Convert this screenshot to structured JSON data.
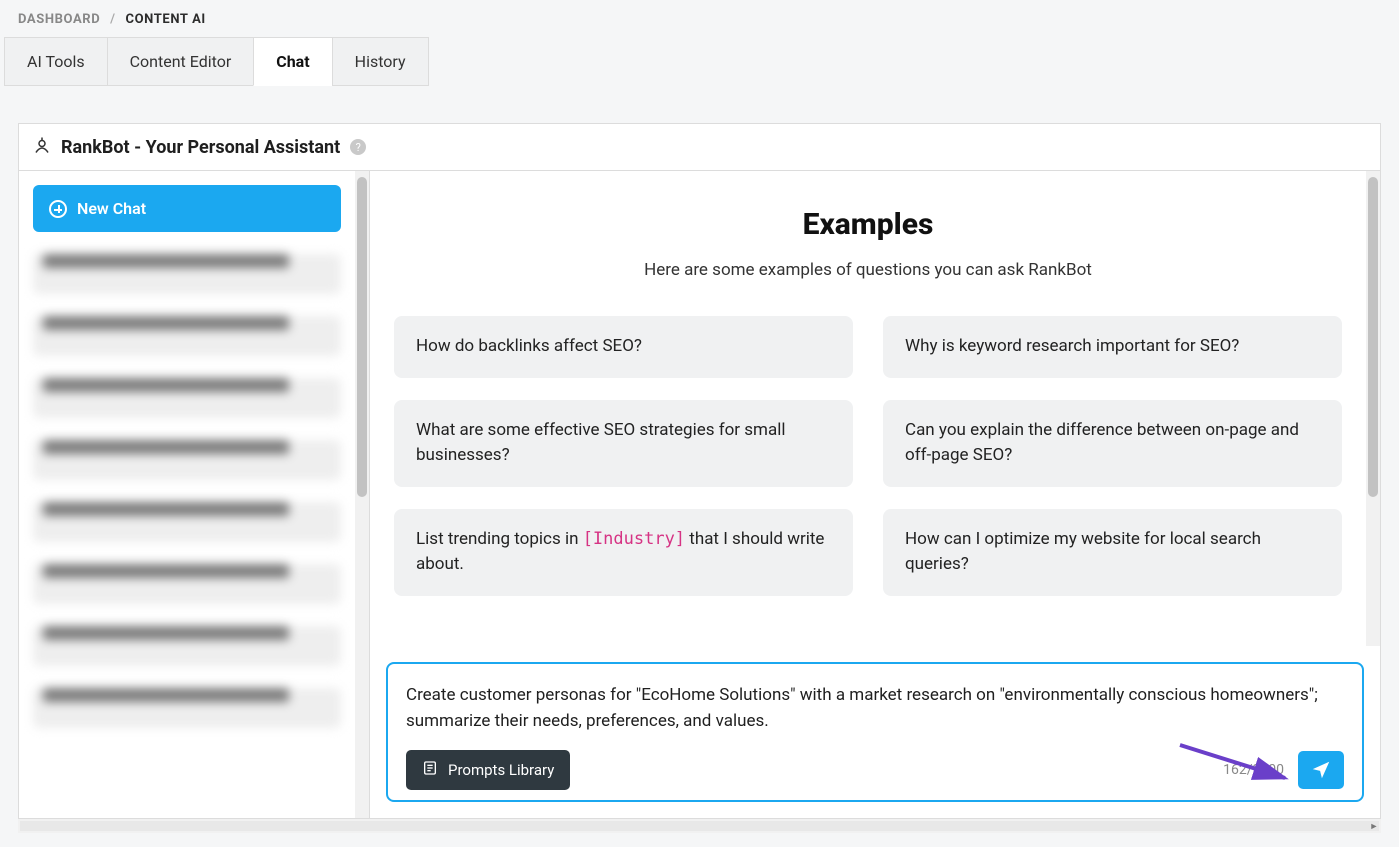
{
  "breadcrumb": {
    "root": "DASHBOARD",
    "current": "CONTENT AI"
  },
  "tabs": {
    "ai_tools": "AI Tools",
    "content_editor": "Content Editor",
    "chat": "Chat",
    "history": "History"
  },
  "panel": {
    "title": "RankBot - Your Personal Assistant",
    "new_chat_label": "New Chat"
  },
  "examples": {
    "heading": "Examples",
    "subheading": "Here are some examples of questions you can ask RankBot",
    "items": [
      "How do backlinks affect SEO?",
      "Why is keyword research important for SEO?",
      "What are some effective SEO strategies for small businesses?",
      "Can you explain the difference between on-page and off-page SEO?",
      {
        "pre": "List trending topics in ",
        "var": "[Industry]",
        "post": " that I should write about."
      },
      "How can I optimize my website for local search queries?"
    ]
  },
  "composer": {
    "text": "Create customer personas for \"EcoHome Solutions\" with a market research on \"environmentally conscious homeowners\"; summarize their needs, preferences, and values.",
    "prompts_library_label": "Prompts Library",
    "counter": "162/2000"
  }
}
